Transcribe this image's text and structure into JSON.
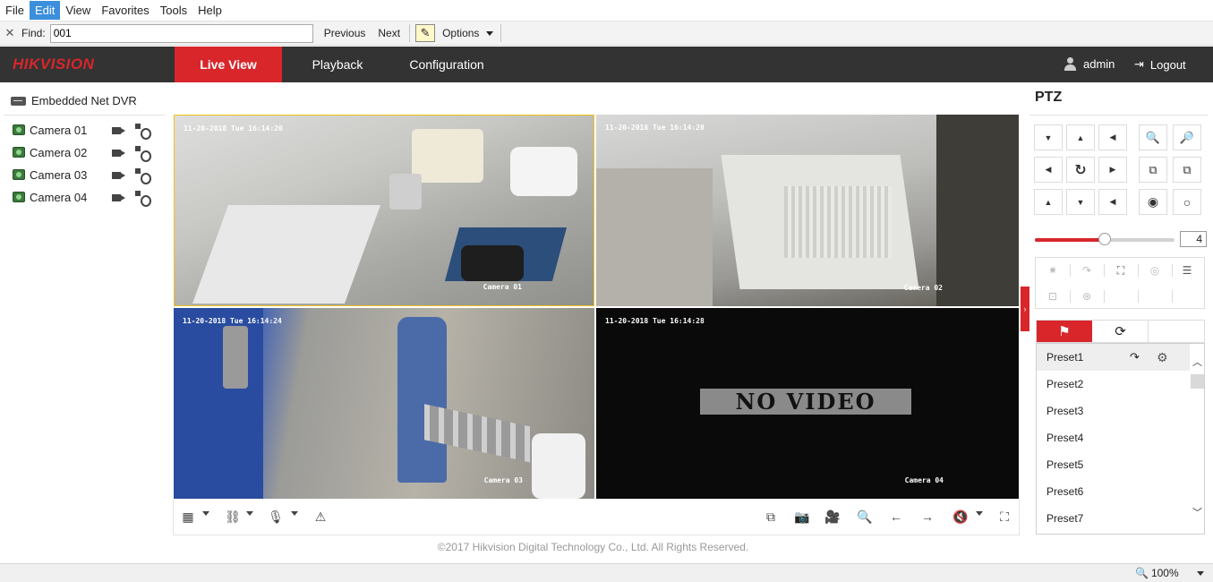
{
  "menubar": {
    "items": [
      "File",
      "Edit",
      "View",
      "Favorites",
      "Tools",
      "Help"
    ],
    "active": "Edit"
  },
  "findbar": {
    "label": "Find:",
    "value": "001",
    "previous": "Previous",
    "next": "Next",
    "options": "Options"
  },
  "nav": {
    "logo": "HIKVISION",
    "tabs": [
      "Live View",
      "Playback",
      "Configuration"
    ],
    "active": "Live View",
    "user": "admin",
    "logout": "Logout"
  },
  "tree": {
    "root": "Embedded Net DVR",
    "cameras": [
      "Camera 01",
      "Camera 02",
      "Camera 03",
      "Camera 04"
    ]
  },
  "video": {
    "panes": [
      {
        "osd": "11-20-2018 Tue 16:14:20",
        "label": "Camera 01"
      },
      {
        "osd": "11-20-2018 Tue 16:14:20",
        "label": "Camera 02"
      },
      {
        "osd": "11-20-2018 Tue 16:14:24",
        "label": "Camera 03"
      },
      {
        "osd": "11-20-2018 Tue 16:14:28",
        "label": "Camera 04"
      }
    ],
    "no_video": "NO VIDEO"
  },
  "copyright": "©2017 Hikvision Digital Technology Co., Ltd. All Rights Reserved.",
  "ptz": {
    "title": "PTZ",
    "speed": "4",
    "speed_fraction": 0.5,
    "presets": [
      "Preset1",
      "Preset2",
      "Preset3",
      "Preset4",
      "Preset5",
      "Preset6",
      "Preset7"
    ],
    "accent": "#d8262b"
  },
  "status": {
    "zoom": "100%"
  }
}
